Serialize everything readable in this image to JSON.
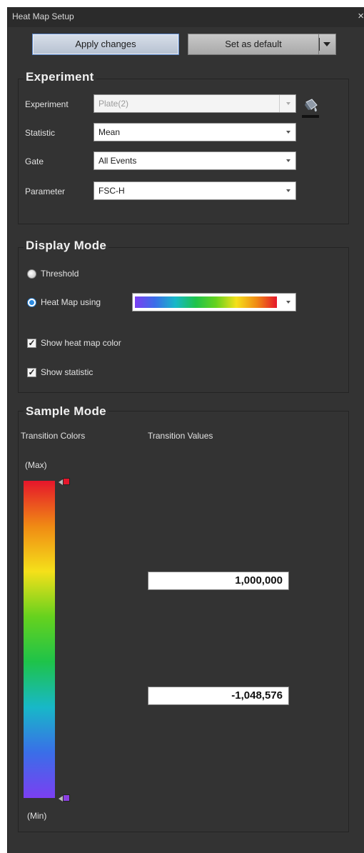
{
  "window": {
    "title": "Heat Map Setup",
    "close": "×"
  },
  "toolbar": {
    "apply_label": "Apply changes",
    "default_label": "Set as default"
  },
  "experiment": {
    "section_title": "Experiment",
    "fields": {
      "experiment": {
        "label": "Experiment",
        "value": "Plate(2)"
      },
      "statistic": {
        "label": "Statistic",
        "value": "Mean"
      },
      "gate": {
        "label": "Gate",
        "value": "All Events"
      },
      "parameter": {
        "label": "Parameter",
        "value": "FSC-H"
      }
    },
    "icon": "paint-bucket-icon"
  },
  "display_mode": {
    "section_title": "Display Mode",
    "threshold_label": "Threshold",
    "heatmap_label": "Heat Map using",
    "selected": "heatmap",
    "show_heat_map_color": {
      "label": "Show heat map color",
      "checked": true
    },
    "show_statistic": {
      "label": "Show statistic",
      "checked": true
    },
    "palette_colors": [
      "#7b3ff2",
      "#3a6ee8",
      "#18b8c8",
      "#1ec34a",
      "#66d21e",
      "#f5e01a",
      "#f08a14",
      "#e5162b"
    ]
  },
  "sample_mode": {
    "section_title": "Sample Mode",
    "transition_colors_label": "Transition Colors",
    "transition_values_label": "Transition Values",
    "max_label": "(Max)",
    "min_label": "(Min)",
    "max_value": "1,000,000",
    "min_value": "-1,048,576",
    "max_color": "#e5162b",
    "min_color": "#8a40e0"
  }
}
